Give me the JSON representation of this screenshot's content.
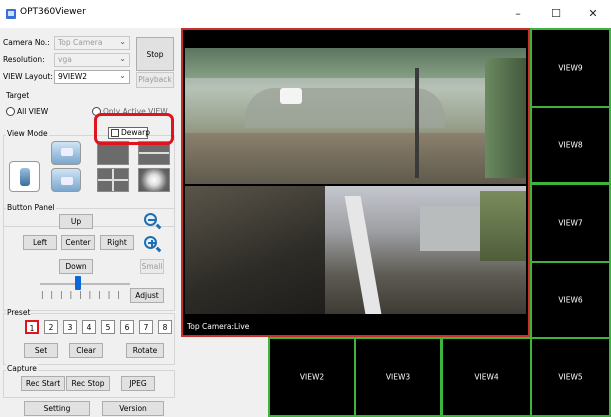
{
  "window": {
    "title": "OPT360Viewer",
    "controls": [
      "–",
      "☐",
      "✕"
    ]
  },
  "left_panel": {
    "camera_no_label": "Camera No.:",
    "camera_no_value": "Top Camera",
    "resolution_label": "Resolution:",
    "resolution_value": "vga",
    "view_layout_label": "VIEW Layout:",
    "view_layout_value": "9VIEW2",
    "stop_label": "Stop",
    "playback_label": "Playback",
    "target": {
      "title": "Target",
      "all_view": "All VIEW",
      "only_active": "Only Active VIEW"
    },
    "view_mode": {
      "title": "View Mode",
      "dewarp_label": "Dewarp"
    },
    "button_panel": {
      "title": "Button Panel",
      "up": "Up",
      "left": "Left",
      "center": "Center",
      "right": "Right",
      "down": "Down",
      "small": "Small",
      "adjust": "Adjust"
    },
    "preset": {
      "title": "Preset",
      "numbers": [
        "1",
        "2",
        "3",
        "4",
        "5",
        "6",
        "7",
        "8"
      ],
      "selected": "1",
      "set": "Set",
      "clear": "Clear",
      "rotate": "Rotate"
    },
    "capture": {
      "title": "Capture",
      "rec_start": "Rec Start",
      "rec_stop": "Rec Stop",
      "jpeg": "JPEG"
    },
    "setting": "Setting",
    "version": "Version"
  },
  "main_view": {
    "caption": "Top Camera:Live"
  },
  "views": {
    "right": [
      "VIEW9",
      "VIEW8",
      "VIEW7",
      "VIEW6",
      "VIEW5"
    ],
    "bottom": [
      "VIEW2",
      "VIEW3",
      "VIEW4"
    ]
  },
  "colors": {
    "active_border": "#c8302c",
    "view_border": "#3db53d",
    "highlight": "#e0141e"
  }
}
